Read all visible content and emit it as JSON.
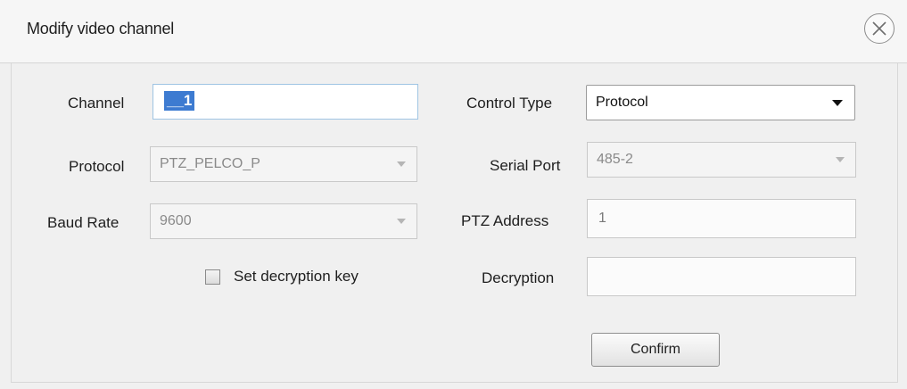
{
  "dialog": {
    "title": "Modify video channel",
    "close_icon": "close-circle-icon"
  },
  "left": {
    "channel": {
      "label": "Channel",
      "value": "__1"
    },
    "protocol": {
      "label": "Protocol",
      "value": "PTZ_PELCO_P"
    },
    "baud_rate": {
      "label": "Baud Rate",
      "value": "9600"
    },
    "set_key": {
      "label": "Set decryption key",
      "checked": false
    }
  },
  "right": {
    "control_type": {
      "label": "Control Type",
      "value": "Protocol"
    },
    "serial_port": {
      "label": "Serial Port",
      "value": "485-2"
    },
    "ptz_address": {
      "label": "PTZ Address",
      "value": "1"
    },
    "decryption": {
      "label": "Decryption",
      "value": ""
    }
  },
  "actions": {
    "confirm_label": "Confirm"
  }
}
